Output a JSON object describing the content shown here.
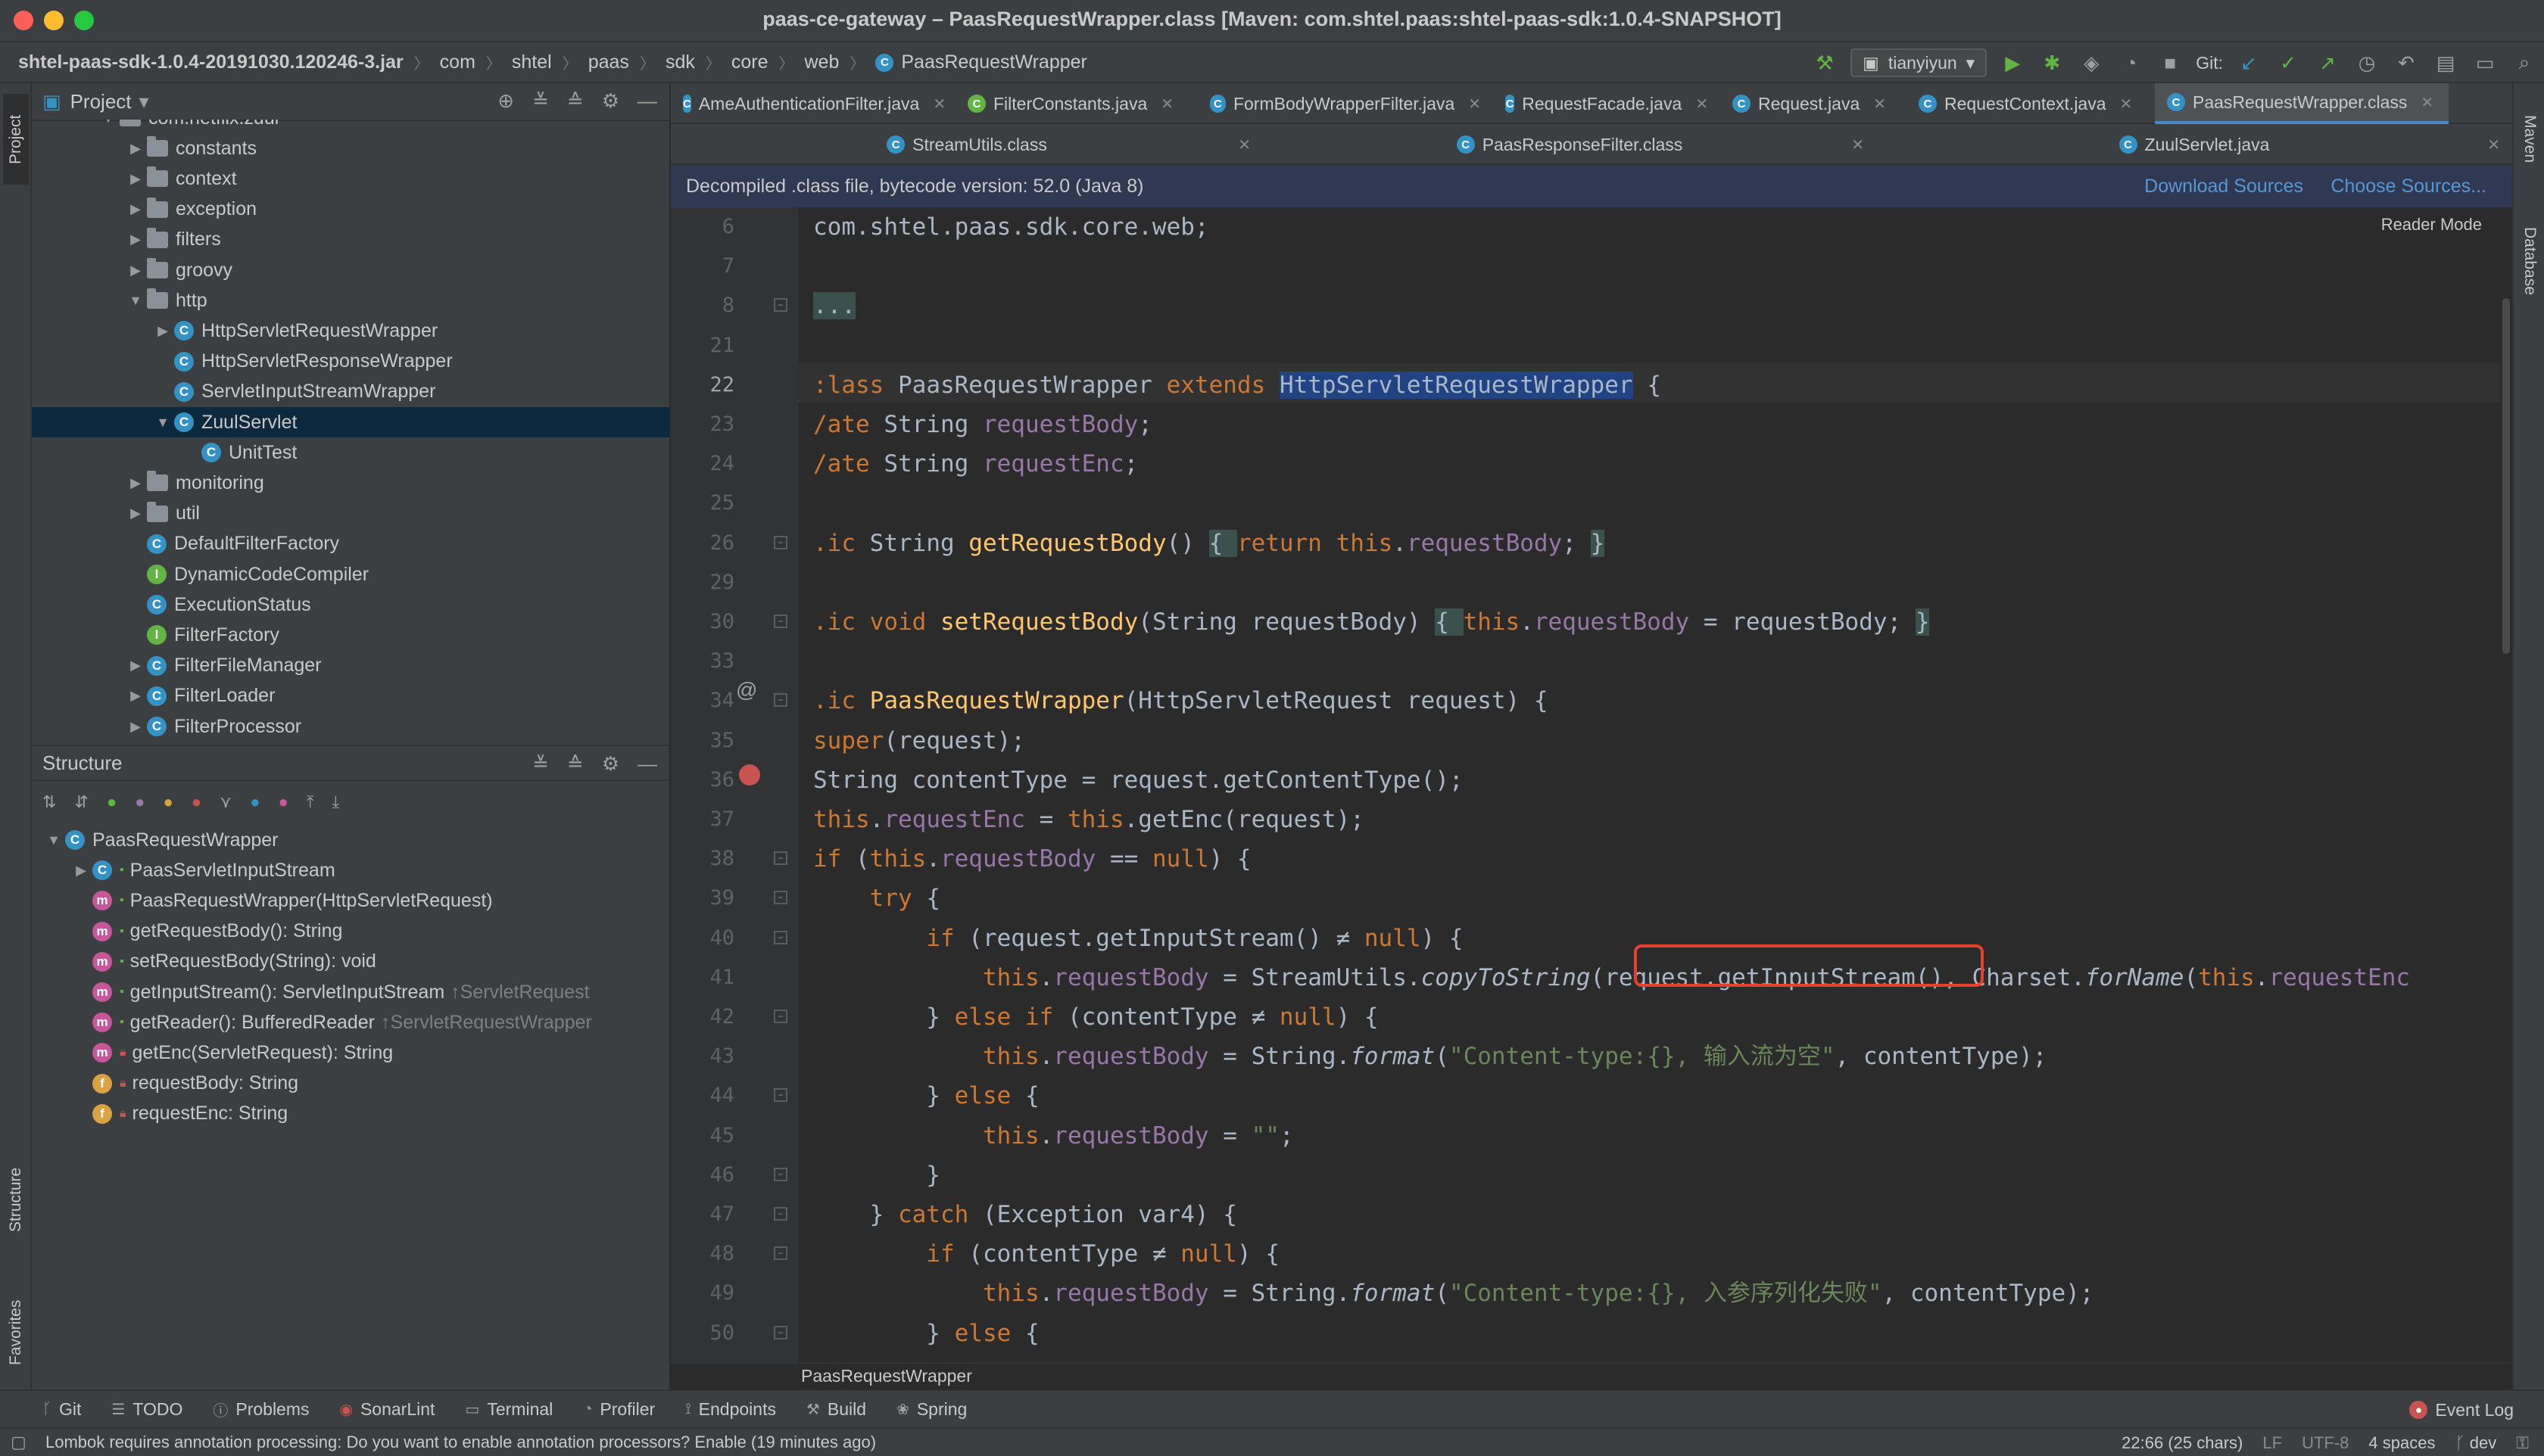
{
  "window": {
    "title": "paas-ce-gateway – PaasRequestWrapper.class [Maven: com.shtel.paas:shtel-paas-sdk:1.0.4-SNAPSHOT]"
  },
  "breadcrumb": [
    "shtel-paas-sdk-1.0.4-20191030.120246-3.jar",
    "com",
    "shtel",
    "paas",
    "sdk",
    "core",
    "web",
    "PaasRequestWrapper"
  ],
  "toolbar": {
    "run_config": "tianyiyun",
    "git_label": "Git:"
  },
  "project_panel": {
    "title": "Project",
    "rows": [
      {
        "label": "com.netflix.zuul",
        "kind": "folder",
        "indent": 2,
        "arrow": "open"
      },
      {
        "label": "constants",
        "kind": "folder",
        "indent": 3,
        "arrow": "closed"
      },
      {
        "label": "context",
        "kind": "folder",
        "indent": 3,
        "arrow": "closed"
      },
      {
        "label": "exception",
        "kind": "folder",
        "indent": 3,
        "arrow": "closed"
      },
      {
        "label": "filters",
        "kind": "folder",
        "indent": 3,
        "arrow": "closed"
      },
      {
        "label": "groovy",
        "kind": "folder",
        "indent": 3,
        "arrow": "closed"
      },
      {
        "label": "http",
        "kind": "folder",
        "indent": 3,
        "arrow": "open"
      },
      {
        "label": "HttpServletRequestWrapper",
        "kind": "class",
        "indent": 4,
        "arrow": "closed"
      },
      {
        "label": "HttpServletResponseWrapper",
        "kind": "class",
        "indent": 4,
        "arrow": ""
      },
      {
        "label": "ServletInputStreamWrapper",
        "kind": "class",
        "indent": 4,
        "arrow": ""
      },
      {
        "label": "ZuulServlet",
        "kind": "class",
        "indent": 4,
        "arrow": "open",
        "selected": true
      },
      {
        "label": "UnitTest",
        "kind": "class",
        "indent": 5,
        "arrow": ""
      },
      {
        "label": "monitoring",
        "kind": "folder",
        "indent": 3,
        "arrow": "closed"
      },
      {
        "label": "util",
        "kind": "folder",
        "indent": 3,
        "arrow": "closed"
      },
      {
        "label": "DefaultFilterFactory",
        "kind": "class",
        "indent": 3,
        "arrow": ""
      },
      {
        "label": "DynamicCodeCompiler",
        "kind": "interface",
        "indent": 3,
        "arrow": ""
      },
      {
        "label": "ExecutionStatus",
        "kind": "class",
        "indent": 3,
        "arrow": ""
      },
      {
        "label": "FilterFactory",
        "kind": "interface",
        "indent": 3,
        "arrow": ""
      },
      {
        "label": "FilterFileManager",
        "kind": "class",
        "indent": 3,
        "arrow": "closed"
      },
      {
        "label": "FilterLoader",
        "kind": "class",
        "indent": 3,
        "arrow": "closed"
      },
      {
        "label": "FilterProcessor",
        "kind": "class",
        "indent": 3,
        "arrow": "closed"
      }
    ]
  },
  "structure_panel": {
    "title": "Structure",
    "rows": [
      {
        "label": "PaasRequestWrapper",
        "kind": "class",
        "indent": 0,
        "arrow": "open",
        "muted": ""
      },
      {
        "label": "PaasServletInputStream",
        "kind": "class",
        "indent": 1,
        "arrow": "closed",
        "muted": ""
      },
      {
        "label": "PaasRequestWrapper(HttpServletRequest)",
        "kind": "method",
        "indent": 1,
        "arrow": "",
        "muted": ""
      },
      {
        "label": "getRequestBody(): String",
        "kind": "method",
        "indent": 1,
        "arrow": "",
        "muted": ""
      },
      {
        "label": "setRequestBody(String): void",
        "kind": "method",
        "indent": 1,
        "arrow": "",
        "muted": ""
      },
      {
        "label": "getInputStream(): ServletInputStream",
        "kind": "method",
        "indent": 1,
        "arrow": "",
        "muted": "↑ServletRequest"
      },
      {
        "label": "getReader(): BufferedReader",
        "kind": "method",
        "indent": 1,
        "arrow": "",
        "muted": "↑ServletRequestWrapper"
      },
      {
        "label": "getEnc(ServletRequest): String",
        "kind": "method-private",
        "indent": 1,
        "arrow": "",
        "muted": ""
      },
      {
        "label": "requestBody: String",
        "kind": "field",
        "indent": 1,
        "arrow": "",
        "muted": ""
      },
      {
        "label": "requestEnc: String",
        "kind": "field",
        "indent": 1,
        "arrow": "",
        "muted": ""
      }
    ]
  },
  "editor_tabs": {
    "row1": [
      "AmeAuthenticationFilter.java",
      "FilterConstants.java",
      "FormBodyWrapperFilter.java",
      "RequestFacade.java",
      "Request.java",
      "RequestContext.java",
      "PaasRequestWrapper.class"
    ],
    "row2": [
      "StreamUtils.class",
      "PaasResponseFilter.class",
      "ZuulServlet.java"
    ],
    "active": "PaasRequestWrapper.class"
  },
  "banner": {
    "text": "Decompiled .class file, bytecode version: 52.0 (Java 8)",
    "download": "Download Sources",
    "choose": "Choose Sources..."
  },
  "reader_mode": "Reader Mode",
  "code": [
    {
      "n": "6",
      "html": "com.shtel.paas.sdk.core.web;"
    },
    {
      "n": "7",
      "html": ""
    },
    {
      "n": "8",
      "html": "<span class='fold'>...</span>"
    },
    {
      "n": "21",
      "html": ""
    },
    {
      "n": "22",
      "html": "<span class='kw'>:lass</span> PaasRequestWrapper <span class='kw'>extends</span> <span class='hl'>HttpServletRequestWrapper</span> {"
    },
    {
      "n": "23",
      "html": "<span class='kw'>/ate</span> String <span class='fld'>requestBody</span>;"
    },
    {
      "n": "24",
      "html": "<span class='kw'>/ate</span> String <span class='fld'>requestEnc</span>;"
    },
    {
      "n": "25",
      "html": ""
    },
    {
      "n": "26",
      "html": "<span class='kw'>.ic</span> String <span class='fn'>getRequestBody</span>() <span class='fold'>{ </span><span class='kw'>return this</span>.<span class='fld'>requestBody</span>; <span class='fold'>}</span>"
    },
    {
      "n": "29",
      "html": ""
    },
    {
      "n": "30",
      "html": "<span class='kw'>.ic void</span> <span class='fn'>setRequestBody</span>(String requestBody) <span class='fold'>{ </span><span class='kw'>this</span>.<span class='fld'>requestBody</span> = requestBody; <span class='fold'>}</span>"
    },
    {
      "n": "33",
      "html": ""
    },
    {
      "n": "34",
      "html": "<span class='kw'>.ic</span> <span class='fn'>PaasRequestWrapper</span>(HttpServletRequest request) {"
    },
    {
      "n": "35",
      "html": "<span class='kw'>super</span>(request);"
    },
    {
      "n": "36",
      "html": "String contentType = request.getContentType();"
    },
    {
      "n": "37",
      "html": "<span class='kw'>this</span>.<span class='fld'>requestEnc</span> = <span class='kw'>this</span>.getEnc(request);"
    },
    {
      "n": "38",
      "html": "<span class='kw'>if</span> (<span class='kw'>this</span>.<span class='fld'>requestBody</span> == <span class='kw'>null</span>) {"
    },
    {
      "n": "39",
      "html": "    <span class='kw'>try</span> {"
    },
    {
      "n": "40",
      "html": "        <span class='kw'>if</span> (request.getInputStream() ≠ <span class='kw'>null</span>) {"
    },
    {
      "n": "41",
      "html": "            <span class='kw'>this</span>.<span class='fld'>requestBody</span> = StreamUtils.<span class='it'>copyToString</span>(request.getInputStream(), Charset.<span class='it'>forName</span>(<span class='kw'>this</span>.<span class='fld'>requestEnc</span>"
    },
    {
      "n": "42",
      "html": "        } <span class='kw'>else if</span> (contentType ≠ <span class='kw'>null</span>) {"
    },
    {
      "n": "43",
      "html": "            <span class='kw'>this</span>.<span class='fld'>requestBody</span> = String.<span class='it'>format</span>(<span class='str'>\"Content-type:{}, 输入流为空\"</span>, contentType);"
    },
    {
      "n": "44",
      "html": "        } <span class='kw'>else</span> {"
    },
    {
      "n": "45",
      "html": "            <span class='kw'>this</span>.<span class='fld'>requestBody</span> = <span class='str'>\"\"</span>;"
    },
    {
      "n": "46",
      "html": "        }"
    },
    {
      "n": "47",
      "html": "    } <span class='kw'>catch</span> (Exception var4) {"
    },
    {
      "n": "48",
      "html": "        <span class='kw'>if</span> (contentType ≠ <span class='kw'>null</span>) {"
    },
    {
      "n": "49",
      "html": "            <span class='kw'>this</span>.<span class='fld'>requestBody</span> = String.<span class='it'>format</span>(<span class='str'>\"Content-type:{}, 入参序列化失败\"</span>, contentType);"
    },
    {
      "n": "50",
      "html": "        } <span class='kw'>else</span> {"
    }
  ],
  "editor_breadcrumb": "PaasRequestWrapper",
  "bottom_tabs": [
    "Git",
    "TODO",
    "Problems",
    "SonarLint",
    "Terminal",
    "Profiler",
    "Endpoints",
    "Build",
    "Spring"
  ],
  "event_log": "Event Log",
  "status": {
    "message": "Lombok requires annotation processing: Do you want to enable annotation processors? Enable (19 minutes ago)",
    "position": "22:66 (25 chars)",
    "line_sep": "LF",
    "encoding": "UTF-8",
    "indent": "4 spaces",
    "branch": "dev"
  },
  "side_tabs": {
    "project": "Project",
    "structure": "Structure",
    "favorites": "Favorites",
    "maven": "Maven",
    "database": "Database"
  },
  "colors": {
    "accent": "#4a88c7",
    "breakpoint": "#c75450",
    "highlight_box": "#e8402e"
  }
}
